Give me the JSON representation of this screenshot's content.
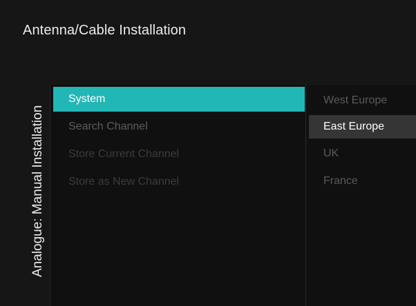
{
  "header": {
    "title": "Antenna/Cable Installation"
  },
  "section": {
    "title": "Analogue: Manual Installation"
  },
  "menu": {
    "items": [
      {
        "label": "System"
      },
      {
        "label": "Search Channel"
      },
      {
        "label": "Store Current Channel"
      },
      {
        "label": "Store as New Channel"
      }
    ]
  },
  "options": {
    "items": [
      {
        "label": "West Europe"
      },
      {
        "label": "East Europe"
      },
      {
        "label": "UK"
      },
      {
        "label": "France"
      }
    ]
  },
  "colors": {
    "accent": "#23b6b6",
    "highlight": "#353535",
    "background": "#101010"
  }
}
